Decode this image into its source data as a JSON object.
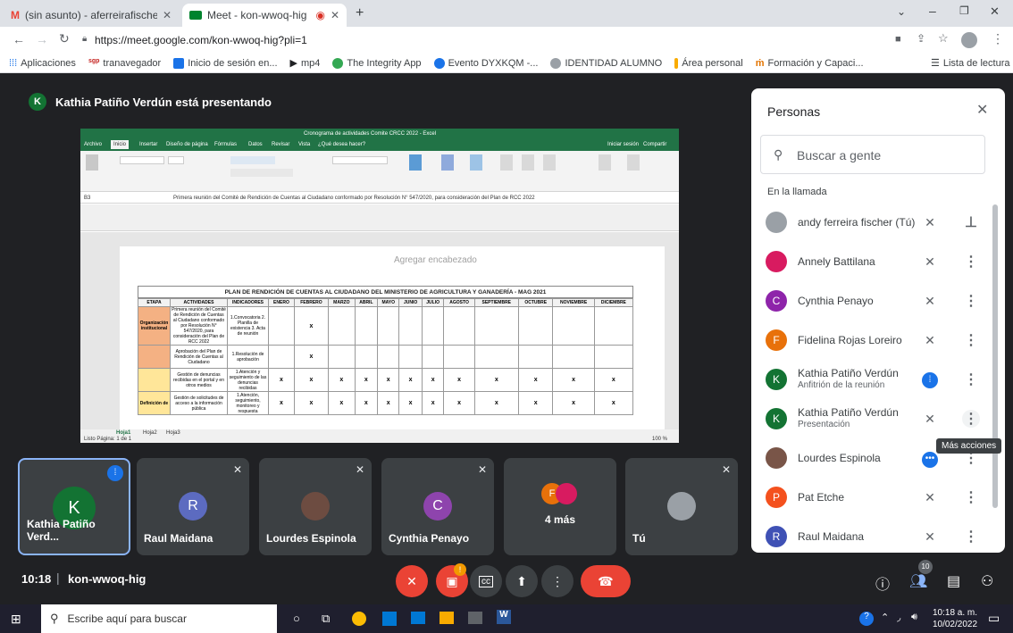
{
  "browser": {
    "tabs": [
      {
        "title": "(sin asunto) - aferreirafischer@gr",
        "icon": "gmail-icon",
        "color": "#ea4335"
      },
      {
        "title": "Meet - kon-wwoq-hig",
        "icon": "meet-icon",
        "color": "#00832d"
      }
    ],
    "url": "https://meet.google.com/kon-wwoq-hig?pli=1",
    "bookmarks": [
      {
        "label": "Aplicaciones",
        "color": "#5f6368"
      },
      {
        "label": "tranavegador",
        "color": "#c5221f"
      },
      {
        "label": "Inicio de sesión en...",
        "color": "#1a73e8"
      },
      {
        "label": "mp4",
        "color": "#202124"
      },
      {
        "label": "The Integrity App",
        "color": "#34a853"
      },
      {
        "label": "Evento DYXKQM -...",
        "color": "#1a73e8"
      },
      {
        "label": "IDENTIDAD ALUMNO",
        "color": "#5f6368"
      },
      {
        "label": "Área personal",
        "color": "#f9ab00"
      },
      {
        "label": "Formación y Capaci...",
        "color": "#e37400"
      }
    ],
    "reading_list": "Lista de lectura"
  },
  "meet": {
    "presenter_text": "Kathia Patiño Verdún está presentando",
    "presenter_initial": "K",
    "time": "10:18",
    "code": "kon-wwoq-hig",
    "participant_count": "10",
    "tiles": [
      {
        "name": "Kathia Patiño Verd...",
        "initial": "K",
        "color": "#137333",
        "speaking": true
      },
      {
        "name": "Raul Maidana",
        "initial": "R",
        "color": "#5c6bc0",
        "speaking": false
      },
      {
        "name": "Lourdes Espinola",
        "initial": "",
        "color": "#3c4043",
        "speaking": false
      },
      {
        "name": "Cynthia Penayo",
        "initial": "C",
        "color": "#8e44ad",
        "speaking": false
      },
      {
        "name": "4 más",
        "initial": "F",
        "color": "#e8710a",
        "speaking": false
      },
      {
        "name": "Tú",
        "initial": "",
        "color": "#3c4043",
        "speaking": false
      }
    ]
  },
  "people": {
    "title": "Personas",
    "search_placeholder": "Buscar a gente",
    "section": "En la llamada",
    "tooltip": "Más acciones",
    "list": [
      {
        "name": "andy ferreira fischer (Tú)",
        "sub": "",
        "initial": "",
        "color": "#9aa0a6"
      },
      {
        "name": "Annely Battilana",
        "sub": "",
        "initial": "",
        "color": "#d81b60"
      },
      {
        "name": "Cynthia Penayo",
        "sub": "",
        "initial": "C",
        "color": "#8e24aa"
      },
      {
        "name": "Fidelina Rojas Loreiro",
        "sub": "",
        "initial": "F",
        "color": "#e8710a"
      },
      {
        "name": "Kathia Patiño Verdún",
        "sub": "Anfitrión de la reunión",
        "initial": "K",
        "color": "#137333"
      },
      {
        "name": "Kathia Patiño Verdún",
        "sub": "Presentación",
        "initial": "K",
        "color": "#137333"
      },
      {
        "name": "Lourdes Espinola",
        "sub": "",
        "initial": "",
        "color": "#795548"
      },
      {
        "name": "Pat Etche",
        "sub": "",
        "initial": "P",
        "color": "#f4511e"
      },
      {
        "name": "Raul Maidana",
        "sub": "",
        "initial": "R",
        "color": "#3f51b5"
      }
    ]
  },
  "excel": {
    "window_title": "Cronograma de actividades Comite CRCC 2022 - Excel",
    "menu": [
      "Archivo",
      "Inicio",
      "Insertar",
      "Diseño de página",
      "Fórmulas",
      "Datos",
      "Revisar",
      "Vista",
      "¿Qué desea hacer?"
    ],
    "signin": "Iniciar sesión",
    "share": "Compartir",
    "cell_ref": "B3",
    "formula": "Primera reunión del Comité de Rendición de Cuentas al Ciudadano conformado por Resolución N° 547/2020, para consideración del Plan de RCC 2022",
    "header_hint": "Agregar encabezado",
    "table_title": "PLAN DE RENDICIÓN DE CUENTAS AL CIUDADANO DEL MINISTERIO DE AGRICULTURA Y GANADERÍA - MAG 2021",
    "headers": [
      "ETAPA",
      "ACTIVIDADES",
      "INDICADORES",
      "ENERO",
      "FEBRERO",
      "MARZO",
      "ABRIL",
      "MAYO",
      "JUNIO",
      "JULIO",
      "AGOSTO",
      "SEPTIEMBRE",
      "OCTUBRE",
      "NOVIEMBRE",
      "DICIEMBRE"
    ],
    "rows": [
      {
        "stage": "Organización institucional",
        "activity": "Primera reunión del Comité de Rendición de Cuentas al Ciudadano conformado por Resolución N° 547/2020, para consideración del Plan de RCC 2022",
        "indicator": "1.Convocatoria 2. Planilla de existencia 3. Acta de reunión",
        "marks": [
          0,
          1,
          0,
          0,
          0,
          0,
          0,
          0,
          0,
          0,
          0,
          0
        ]
      },
      {
        "stage": "",
        "activity": "Aprobación del Plan de Rendición de Cuentas al Ciudadano",
        "indicator": "1.Resolución de aprobación",
        "marks": [
          0,
          1,
          0,
          0,
          0,
          0,
          0,
          0,
          0,
          0,
          0,
          0
        ]
      },
      {
        "stage": "",
        "activity": "Gestión de denuncias recibidas en el portal y en otros medios",
        "indicator": "1.Atención y seguimiento de las denuncias recibidas",
        "marks": [
          1,
          1,
          1,
          1,
          1,
          1,
          1,
          1,
          1,
          1,
          1,
          1
        ]
      },
      {
        "stage": "Definición de",
        "activity": "Gestión de solicitudes de acceso a la información pública",
        "indicator": "1.Atención, seguimiento, monitoreo y respuesta",
        "marks": [
          1,
          1,
          1,
          1,
          1,
          1,
          1,
          1,
          1,
          1,
          1,
          1
        ]
      }
    ],
    "sheets": [
      "Hoja1",
      "Hoja2",
      "Hoja3"
    ],
    "status": "Listo   Página: 1 de 1",
    "zoom": "100 %"
  },
  "taskbar": {
    "search": "Escribe aquí para buscar",
    "time": "10:18 a. m.",
    "date": "10/02/2022"
  }
}
